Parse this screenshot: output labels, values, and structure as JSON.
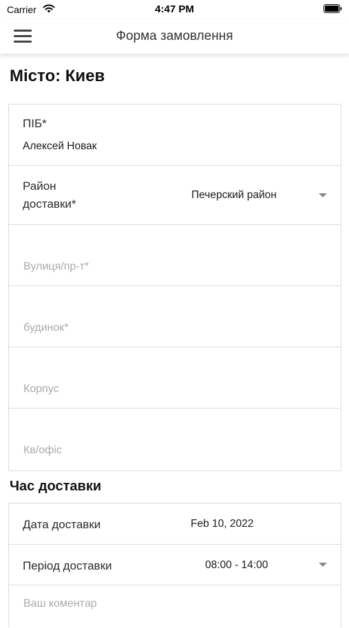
{
  "status_bar": {
    "carrier": "Carrier",
    "time": "4:47 PM"
  },
  "nav": {
    "title": "Форма замовлення"
  },
  "city_heading": "Місто: Киев",
  "form": {
    "name_label": "ПІБ*",
    "name_value": "Алексей Новак",
    "district_label_line1": "Район",
    "district_label_line2": "доставки*",
    "district_value": "Печерский район",
    "street_placeholder": "Вулиця/пр-т*",
    "house_placeholder": "будинок*",
    "building_placeholder": "Корпус",
    "apartment_placeholder": "Кв/офіс"
  },
  "delivery": {
    "heading": "Час доставки",
    "date_label": "Дата доставки",
    "date_value": "Feb 10, 2022",
    "period_label": "Період доставки",
    "period_value": "08:00 - 14:00",
    "comment_placeholder": "Ваш коментар"
  },
  "icons": {
    "menu": "hamburger-menu-icon",
    "wifi": "wifi-icon",
    "battery": "battery-icon",
    "dropdown": "chevron-down-icon"
  }
}
